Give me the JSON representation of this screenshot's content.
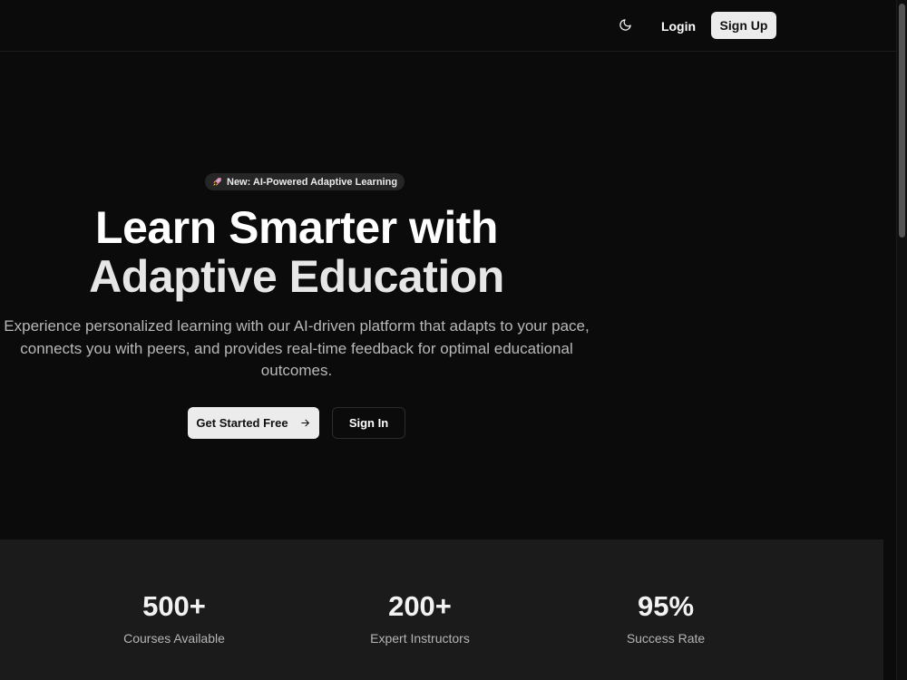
{
  "header": {
    "theme_toggle_icon": "moon-icon",
    "login_label": "Login",
    "signup_label": "Sign Up"
  },
  "hero": {
    "badge": {
      "icon": "rocket-icon",
      "text": "New: AI-Powered Adaptive Learning"
    },
    "title_line1": "Learn Smarter with",
    "title_line2": "Adaptive Education",
    "description": "Experience personalized learning with our AI-driven platform that adapts to your pace, connects you with peers, and provides real-time feedback for optimal educational outcomes.",
    "primary_cta": {
      "label": "Get Started Free",
      "icon": "arrow-right-icon"
    },
    "secondary_cta": {
      "label": "Sign In"
    }
  },
  "stats": [
    {
      "value": "500+",
      "label": "Courses Available"
    },
    {
      "value": "200+",
      "label": "Expert Instructors"
    },
    {
      "value": "95%",
      "label": "Success Rate"
    }
  ],
  "colors": {
    "background": "#0b0b0b",
    "stats_background": "#1b1b1b",
    "button_light": "#ececec",
    "text_primary": "#ffffff",
    "text_muted": "#b8b8b8"
  }
}
